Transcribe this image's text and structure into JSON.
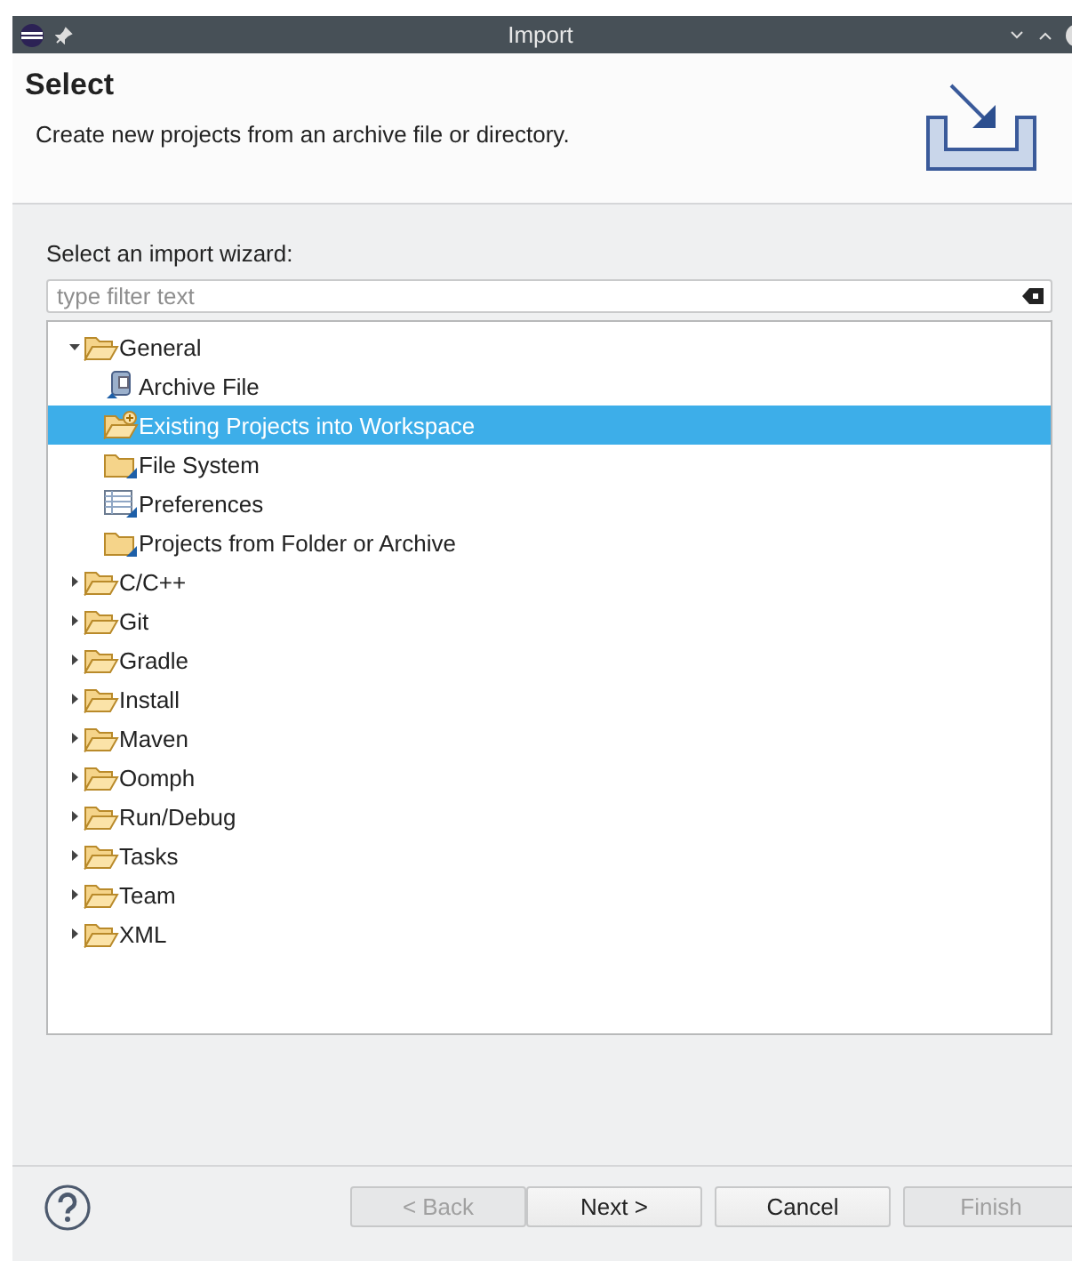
{
  "window": {
    "title": "Import"
  },
  "header": {
    "title": "Select",
    "description": "Create new projects from an archive file or directory."
  },
  "wizard_label": "Select an import wizard:",
  "filter": {
    "placeholder": "type filter text"
  },
  "tree": [
    {
      "label": "General",
      "kind": "folder",
      "expanded": true,
      "selected": false,
      "children": [
        {
          "label": "Archive File",
          "kind": "archive",
          "selected": false
        },
        {
          "label": "Existing Projects into Workspace",
          "kind": "project",
          "selected": true
        },
        {
          "label": "File System",
          "kind": "plainfolder",
          "selected": false
        },
        {
          "label": "Preferences",
          "kind": "table",
          "selected": false
        },
        {
          "label": "Projects from Folder or Archive",
          "kind": "plainfolder",
          "selected": false
        }
      ]
    },
    {
      "label": "C/C++",
      "kind": "folder",
      "expanded": false,
      "selected": false
    },
    {
      "label": "Git",
      "kind": "folder",
      "expanded": false,
      "selected": false
    },
    {
      "label": "Gradle",
      "kind": "folder",
      "expanded": false,
      "selected": false
    },
    {
      "label": "Install",
      "kind": "folder",
      "expanded": false,
      "selected": false
    },
    {
      "label": "Maven",
      "kind": "folder",
      "expanded": false,
      "selected": false
    },
    {
      "label": "Oomph",
      "kind": "folder",
      "expanded": false,
      "selected": false
    },
    {
      "label": "Run/Debug",
      "kind": "folder",
      "expanded": false,
      "selected": false
    },
    {
      "label": "Tasks",
      "kind": "folder",
      "expanded": false,
      "selected": false
    },
    {
      "label": "Team",
      "kind": "folder",
      "expanded": false,
      "selected": false
    },
    {
      "label": "XML",
      "kind": "folder",
      "expanded": false,
      "selected": false
    }
  ],
  "buttons": [
    {
      "label": "< Back",
      "disabled": true
    },
    {
      "label": "Next >",
      "disabled": false
    },
    {
      "label": "Cancel",
      "disabled": false
    },
    {
      "label": "Finish",
      "disabled": true
    }
  ]
}
